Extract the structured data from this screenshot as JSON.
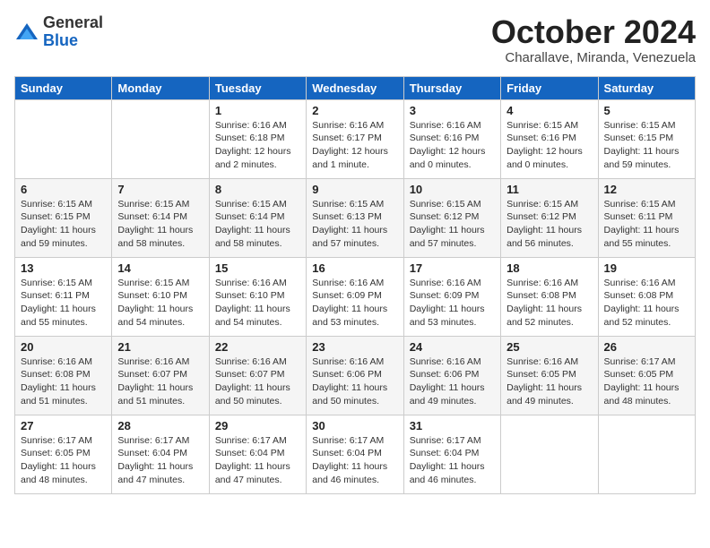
{
  "logo": {
    "general": "General",
    "blue": "Blue"
  },
  "title": "October 2024",
  "location": "Charallave, Miranda, Venezuela",
  "days_of_week": [
    "Sunday",
    "Monday",
    "Tuesday",
    "Wednesday",
    "Thursday",
    "Friday",
    "Saturday"
  ],
  "weeks": [
    [
      {
        "day": "",
        "info": ""
      },
      {
        "day": "",
        "info": ""
      },
      {
        "day": "1",
        "info": "Sunrise: 6:16 AM\nSunset: 6:18 PM\nDaylight: 12 hours\nand 2 minutes."
      },
      {
        "day": "2",
        "info": "Sunrise: 6:16 AM\nSunset: 6:17 PM\nDaylight: 12 hours\nand 1 minute."
      },
      {
        "day": "3",
        "info": "Sunrise: 6:16 AM\nSunset: 6:16 PM\nDaylight: 12 hours\nand 0 minutes."
      },
      {
        "day": "4",
        "info": "Sunrise: 6:15 AM\nSunset: 6:16 PM\nDaylight: 12 hours\nand 0 minutes."
      },
      {
        "day": "5",
        "info": "Sunrise: 6:15 AM\nSunset: 6:15 PM\nDaylight: 11 hours\nand 59 minutes."
      }
    ],
    [
      {
        "day": "6",
        "info": "Sunrise: 6:15 AM\nSunset: 6:15 PM\nDaylight: 11 hours\nand 59 minutes."
      },
      {
        "day": "7",
        "info": "Sunrise: 6:15 AM\nSunset: 6:14 PM\nDaylight: 11 hours\nand 58 minutes."
      },
      {
        "day": "8",
        "info": "Sunrise: 6:15 AM\nSunset: 6:14 PM\nDaylight: 11 hours\nand 58 minutes."
      },
      {
        "day": "9",
        "info": "Sunrise: 6:15 AM\nSunset: 6:13 PM\nDaylight: 11 hours\nand 57 minutes."
      },
      {
        "day": "10",
        "info": "Sunrise: 6:15 AM\nSunset: 6:12 PM\nDaylight: 11 hours\nand 57 minutes."
      },
      {
        "day": "11",
        "info": "Sunrise: 6:15 AM\nSunset: 6:12 PM\nDaylight: 11 hours\nand 56 minutes."
      },
      {
        "day": "12",
        "info": "Sunrise: 6:15 AM\nSunset: 6:11 PM\nDaylight: 11 hours\nand 55 minutes."
      }
    ],
    [
      {
        "day": "13",
        "info": "Sunrise: 6:15 AM\nSunset: 6:11 PM\nDaylight: 11 hours\nand 55 minutes."
      },
      {
        "day": "14",
        "info": "Sunrise: 6:15 AM\nSunset: 6:10 PM\nDaylight: 11 hours\nand 54 minutes."
      },
      {
        "day": "15",
        "info": "Sunrise: 6:16 AM\nSunset: 6:10 PM\nDaylight: 11 hours\nand 54 minutes."
      },
      {
        "day": "16",
        "info": "Sunrise: 6:16 AM\nSunset: 6:09 PM\nDaylight: 11 hours\nand 53 minutes."
      },
      {
        "day": "17",
        "info": "Sunrise: 6:16 AM\nSunset: 6:09 PM\nDaylight: 11 hours\nand 53 minutes."
      },
      {
        "day": "18",
        "info": "Sunrise: 6:16 AM\nSunset: 6:08 PM\nDaylight: 11 hours\nand 52 minutes."
      },
      {
        "day": "19",
        "info": "Sunrise: 6:16 AM\nSunset: 6:08 PM\nDaylight: 11 hours\nand 52 minutes."
      }
    ],
    [
      {
        "day": "20",
        "info": "Sunrise: 6:16 AM\nSunset: 6:08 PM\nDaylight: 11 hours\nand 51 minutes."
      },
      {
        "day": "21",
        "info": "Sunrise: 6:16 AM\nSunset: 6:07 PM\nDaylight: 11 hours\nand 51 minutes."
      },
      {
        "day": "22",
        "info": "Sunrise: 6:16 AM\nSunset: 6:07 PM\nDaylight: 11 hours\nand 50 minutes."
      },
      {
        "day": "23",
        "info": "Sunrise: 6:16 AM\nSunset: 6:06 PM\nDaylight: 11 hours\nand 50 minutes."
      },
      {
        "day": "24",
        "info": "Sunrise: 6:16 AM\nSunset: 6:06 PM\nDaylight: 11 hours\nand 49 minutes."
      },
      {
        "day": "25",
        "info": "Sunrise: 6:16 AM\nSunset: 6:05 PM\nDaylight: 11 hours\nand 49 minutes."
      },
      {
        "day": "26",
        "info": "Sunrise: 6:17 AM\nSunset: 6:05 PM\nDaylight: 11 hours\nand 48 minutes."
      }
    ],
    [
      {
        "day": "27",
        "info": "Sunrise: 6:17 AM\nSunset: 6:05 PM\nDaylight: 11 hours\nand 48 minutes."
      },
      {
        "day": "28",
        "info": "Sunrise: 6:17 AM\nSunset: 6:04 PM\nDaylight: 11 hours\nand 47 minutes."
      },
      {
        "day": "29",
        "info": "Sunrise: 6:17 AM\nSunset: 6:04 PM\nDaylight: 11 hours\nand 47 minutes."
      },
      {
        "day": "30",
        "info": "Sunrise: 6:17 AM\nSunset: 6:04 PM\nDaylight: 11 hours\nand 46 minutes."
      },
      {
        "day": "31",
        "info": "Sunrise: 6:17 AM\nSunset: 6:04 PM\nDaylight: 11 hours\nand 46 minutes."
      },
      {
        "day": "",
        "info": ""
      },
      {
        "day": "",
        "info": ""
      }
    ]
  ]
}
